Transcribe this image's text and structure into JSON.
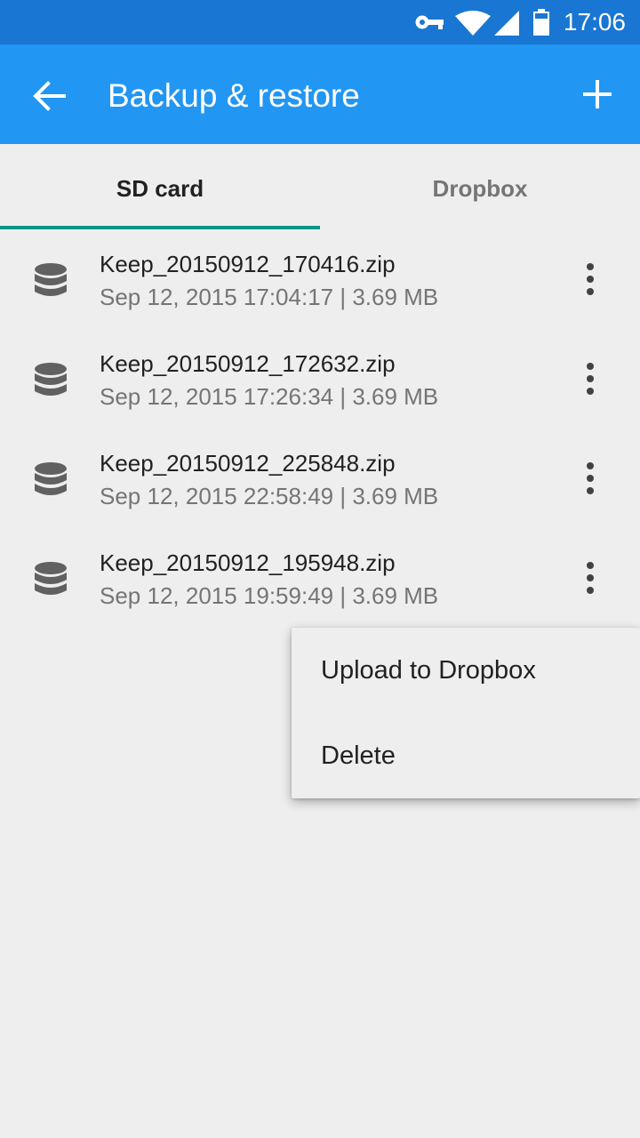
{
  "status_bar": {
    "time": "17:06",
    "icons": [
      "key-icon",
      "wifi-icon",
      "signal-icon",
      "battery-icon"
    ]
  },
  "app_bar": {
    "title": "Backup & restore",
    "back_icon": "arrow-back-icon",
    "add_icon": "plus-icon",
    "color": "#2196f3"
  },
  "tabs": [
    {
      "label": "SD card",
      "active": true
    },
    {
      "label": "Dropbox",
      "active": false
    }
  ],
  "accent_color": "#009688",
  "backups": [
    {
      "name": "Keep_20150912_170416.zip",
      "meta": "Sep 12, 2015 17:04:17 | 3.69 MB"
    },
    {
      "name": "Keep_20150912_172632.zip",
      "meta": "Sep 12, 2015 17:26:34 | 3.69 MB"
    },
    {
      "name": "Keep_20150912_225848.zip",
      "meta": "Sep 12, 2015 22:58:49 | 3.69 MB"
    },
    {
      "name": "Keep_20150912_195948.zip",
      "meta": "Sep 12, 2015 19:59:49 | 3.69 MB"
    }
  ],
  "context_menu": {
    "items": [
      "Upload to Dropbox",
      "Delete"
    ]
  }
}
